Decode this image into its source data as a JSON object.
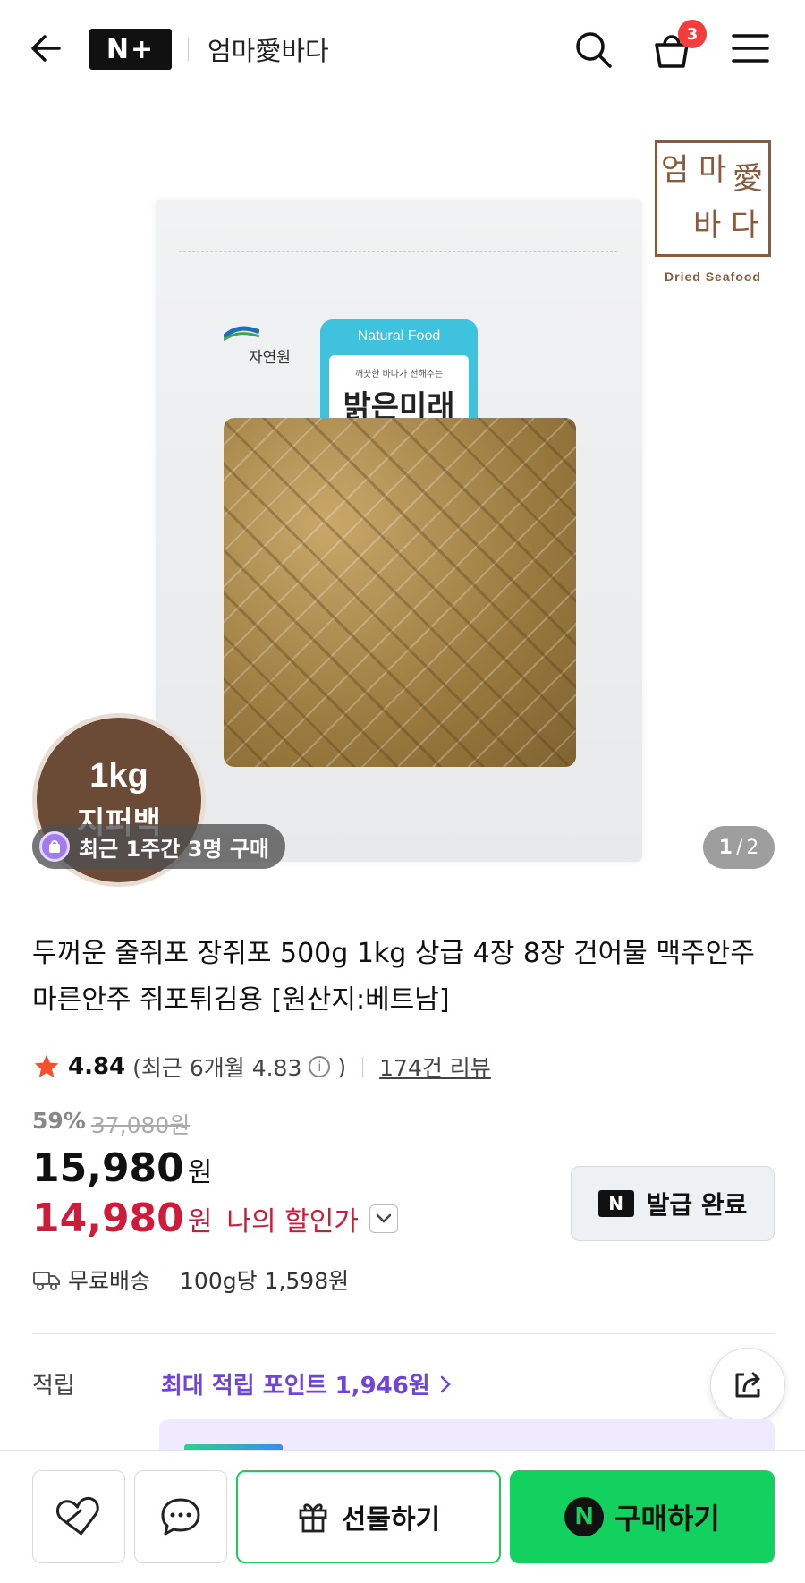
{
  "header": {
    "brand_badge": "N+",
    "store_name": "엄마愛바다",
    "cart_count": "3"
  },
  "gallery": {
    "page_current": "1",
    "page_sep": "/",
    "page_total": "2",
    "recent_purchase": "최근 1주간 3명 구매",
    "stamp_line1": "1kg",
    "stamp_line2": "지퍼백",
    "package": {
      "maker_logo": "자연원",
      "label_top": "Natural Food",
      "label_sub": "깨끗한 바다가 전해주는",
      "label_brand": "밝은미래"
    },
    "logo": {
      "chars": [
        "엄",
        "마",
        "愛",
        "바",
        "다"
      ],
      "sub": "Dried Seafood"
    }
  },
  "product": {
    "title": "두꺼운 줄쥐포 장쥐포 500g 1kg 상급 4장 8장 건어물 맥주안주 마른안주 쥐포튀김용 [원산지:베트남]",
    "rating": "4.84",
    "rating_recent_prefix": "(최근 6개월 4.83",
    "rating_recent_suffix": ")",
    "review_link": "174건 리뷰",
    "discount_rate": "59%",
    "original_price": "37,080원",
    "price": "15,980",
    "price_unit": "원",
    "my_price": "14,980",
    "my_price_unit": "원",
    "my_price_label": "나의 할인가",
    "coupon_button": "발급 완료",
    "shipping": "무료배송",
    "unit_price": "100g당 1,598원",
    "points_label": "적립",
    "points_value": "최대 적립 포인트 1,946원"
  },
  "bottom_bar": {
    "gift_label": "선물하기",
    "buy_label": "구매하기"
  },
  "colors": {
    "accent_green": "#13d15e",
    "price_red": "#d01a3a",
    "points_purple": "#6e45d8",
    "badge_red": "#f23d3d"
  }
}
